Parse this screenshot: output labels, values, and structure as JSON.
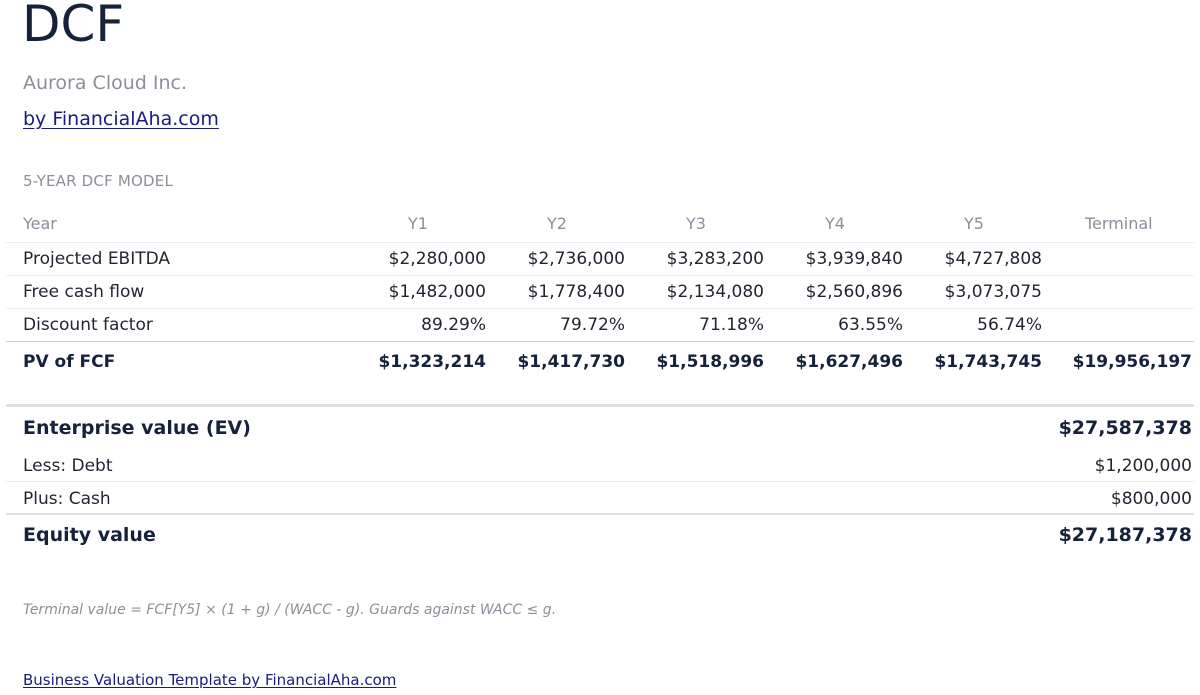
{
  "header": {
    "title": "DCF",
    "company": "Aurora Cloud Inc.",
    "brand_link": "by FinancialAha.com"
  },
  "model": {
    "section_label": "5-YEAR DCF MODEL",
    "columns": [
      "Year",
      "Y1",
      "Y2",
      "Y3",
      "Y4",
      "Y5",
      "Terminal"
    ],
    "rows": [
      {
        "label": "Projected EBITDA",
        "values": [
          "$2,280,000",
          "$2,736,000",
          "$3,283,200",
          "$3,939,840",
          "$4,727,808",
          ""
        ]
      },
      {
        "label": "Free cash flow",
        "values": [
          "$1,482,000",
          "$1,778,400",
          "$2,134,080",
          "$2,560,896",
          "$3,073,075",
          ""
        ]
      },
      {
        "label": "Discount factor",
        "values": [
          "89.29%",
          "79.72%",
          "71.18%",
          "63.55%",
          "56.74%",
          ""
        ]
      }
    ],
    "total_row": {
      "label": "PV of FCF",
      "values": [
        "$1,323,214",
        "$1,417,730",
        "$1,518,996",
        "$1,627,496",
        "$1,743,745",
        "$19,956,197"
      ]
    }
  },
  "valuation": {
    "enterprise_value": {
      "label": "Enterprise value (EV)",
      "value": "$27,587,378"
    },
    "debt": {
      "label": "Less: Debt",
      "value": "$1,200,000"
    },
    "cash": {
      "label": "Plus: Cash",
      "value": "$800,000"
    },
    "equity_value": {
      "label": "Equity value",
      "value": "$27,187,378"
    }
  },
  "note": "Terminal value = FCF[Y5] × (1 + g) / (WACC - g). Guards against WACC ≤ g.",
  "footer": {
    "link_text": "Business Valuation Template by FinancialAha.com"
  }
}
